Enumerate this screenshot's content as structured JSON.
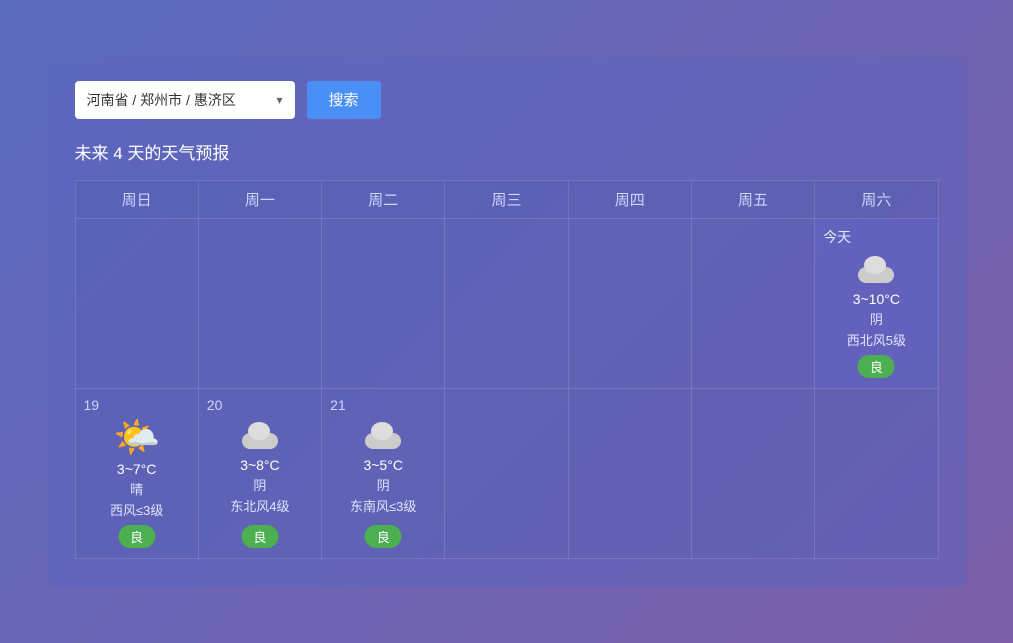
{
  "search": {
    "location_text": "河南省 / 郑州市 / 惠济区",
    "button_label": "搜索"
  },
  "forecast_title": "未来 4 天的天气预报",
  "weekdays": [
    {
      "label": "周日"
    },
    {
      "label": "周一"
    },
    {
      "label": "周二"
    },
    {
      "label": "周三"
    },
    {
      "label": "周四"
    },
    {
      "label": "周五"
    },
    {
      "label": "周六"
    }
  ],
  "row1": {
    "cells": [
      {
        "date": "",
        "icon": "",
        "temp": "",
        "condition": "",
        "wind": "",
        "quality": "",
        "empty": true
      },
      {
        "date": "",
        "icon": "",
        "temp": "",
        "condition": "",
        "wind": "",
        "quality": "",
        "empty": true
      },
      {
        "date": "",
        "icon": "",
        "temp": "",
        "condition": "",
        "wind": "",
        "quality": "",
        "empty": true
      },
      {
        "date": "",
        "icon": "",
        "temp": "",
        "condition": "",
        "wind": "",
        "quality": "",
        "empty": true
      },
      {
        "date": "",
        "icon": "",
        "temp": "",
        "condition": "",
        "wind": "",
        "quality": "",
        "empty": true
      },
      {
        "date": "",
        "icon": "",
        "temp": "",
        "condition": "",
        "wind": "",
        "quality": "",
        "empty": true
      },
      {
        "today_label": "今天",
        "icon": "cloud",
        "temp": "3~10°C",
        "condition": "阴",
        "wind": "西北风5级",
        "quality": "良",
        "empty": false
      }
    ]
  },
  "row2": {
    "cells": [
      {
        "date": "19",
        "icon": "sun",
        "temp": "3~7°C",
        "condition": "晴",
        "wind": "西风≤3级",
        "quality": "良",
        "empty": false
      },
      {
        "date": "20",
        "icon": "cloud",
        "temp": "3~8°C",
        "condition": "阴",
        "wind": "东北风4级",
        "quality": "良",
        "empty": false
      },
      {
        "date": "21",
        "icon": "cloud",
        "temp": "3~5°C",
        "condition": "阴",
        "wind": "东南风≤3级",
        "quality": "良",
        "empty": false
      },
      {
        "date": "",
        "icon": "",
        "temp": "",
        "condition": "",
        "wind": "",
        "quality": "",
        "empty": true
      },
      {
        "date": "",
        "icon": "",
        "temp": "",
        "condition": "",
        "wind": "",
        "quality": "",
        "empty": true
      },
      {
        "date": "",
        "icon": "",
        "temp": "",
        "condition": "",
        "wind": "",
        "quality": "",
        "empty": true
      },
      {
        "date": "",
        "icon": "",
        "temp": "",
        "condition": "",
        "wind": "",
        "quality": "",
        "empty": true
      }
    ]
  }
}
